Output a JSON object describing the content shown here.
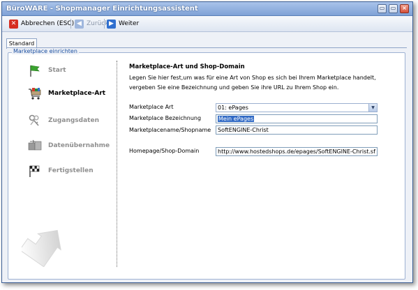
{
  "window": {
    "title": "BüroWARE - Shopmanager Einrichtungsassistent",
    "controls": {
      "minimize": "▭",
      "maximize": "▭",
      "close": "×"
    }
  },
  "toolbar": {
    "cancel_label": "Abbrechen (ESC)",
    "back_label": "Zurück",
    "next_label": "Weiter"
  },
  "tabs": [
    {
      "label": "Standard",
      "active": true
    }
  ],
  "group": {
    "legend": "Marketplace einrichten"
  },
  "steps": [
    {
      "label": "Start",
      "icon": "flag-icon",
      "active": false
    },
    {
      "label": "Marketplace-Art",
      "icon": "shopping-cart-icon",
      "active": true
    },
    {
      "label": "Zugangsdaten",
      "icon": "keys-icon",
      "active": false
    },
    {
      "label": "Datenübernahme",
      "icon": "data-transfer-icon",
      "active": false
    },
    {
      "label": "Fertigstellen",
      "icon": "checkered-flag-icon",
      "active": false
    }
  ],
  "content": {
    "heading": "Marketplace-Art und Shop-Domain",
    "description": "Legen Sie hier fest,um was für eine Art von Shop es sich bei Ihrem Marketplace handelt, vergeben Sie eine Bezeichnung und geben Sie ihre URL zu Ihrem Shop ein.",
    "fields": {
      "marketplace_art": {
        "label": "Marketplace Art",
        "value": "01: ePages"
      },
      "bezeichnung": {
        "label": "Marketplace Bezeichnung",
        "value": "Mein ePages"
      },
      "shopname": {
        "label": "Marketplacename/Shopname",
        "value": "SoftENGINE-Christ"
      },
      "homepage": {
        "label": "Homepage/Shop-Domain",
        "value": "http://www.hostedshops.de/epages/SoftENGINE-Christ.sf"
      }
    }
  },
  "colors": {
    "accent": "#316ac5",
    "title_bar": "#7fa2d6",
    "legend_text": "#1a4fa0"
  }
}
